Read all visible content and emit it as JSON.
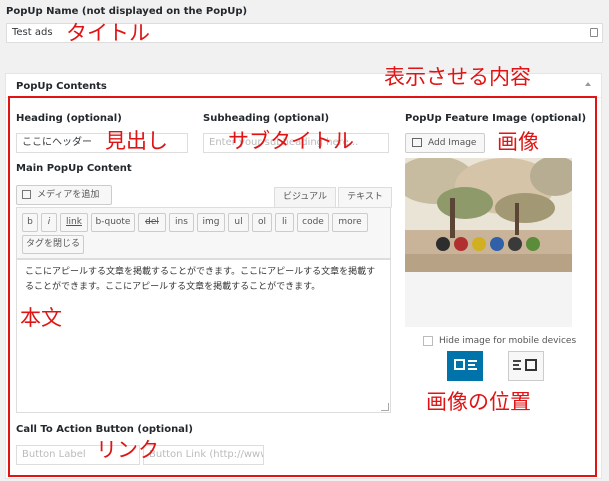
{
  "popup_name": {
    "label": "PopUp Name (not displayed on the PopUp)",
    "value": "Test ads",
    "annotation": "タイトル"
  },
  "contents_box": {
    "title": "PopUp Contents",
    "annotation": "表示させる内容"
  },
  "heading": {
    "label": "Heading (optional)",
    "value": "ここにヘッダー",
    "annotation": "見出し"
  },
  "subheading": {
    "label": "Subheading (optional)",
    "placeholder": "Enter your subheading here...",
    "annotation": "サブタイトル"
  },
  "main_content": {
    "label": "Main PopUp Content",
    "add_media": "メディアを追加",
    "tab_visual": "ビジュアル",
    "tab_text": "テキスト",
    "quicktags": [
      "b",
      "i",
      "link",
      "b-quote",
      "del",
      "ins",
      "img",
      "ul",
      "ol",
      "li",
      "code",
      "more"
    ],
    "close_tags": "タグを閉じる",
    "body_text": "ここにアピールする文章を掲載することができます。ここにアピールする文章を掲載することができます。ここにアピールする文章を掲載することができます。",
    "annotation": "本文"
  },
  "feature_image": {
    "label": "PopUp Feature Image (optional)",
    "add_image": "Add Image",
    "annotation": "画像",
    "hide_mobile_label": "Hide image for mobile devices",
    "hide_mobile_checked": false,
    "position_annotation": "画像の位置",
    "position_selected": "image-left"
  },
  "cta": {
    "label": "Call To Action Button (optional)",
    "button_label_placeholder": "Button Label",
    "button_link_placeholder": "Button Link (http://www",
    "annotation": "リンク"
  },
  "colors": {
    "annotation": "#e01414",
    "selected": "#0073aa"
  }
}
